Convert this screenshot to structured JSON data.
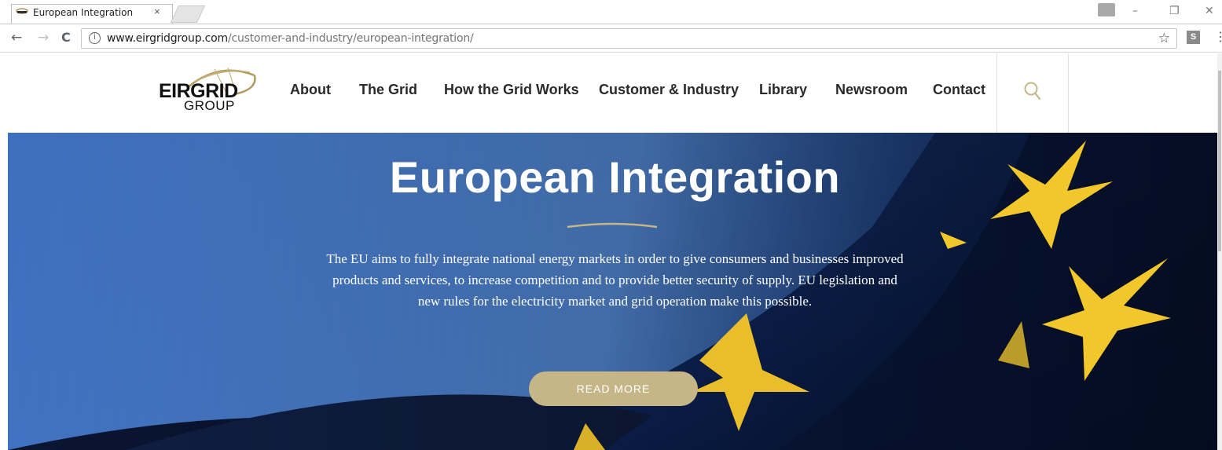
{
  "browser": {
    "tab_title": "European Integration",
    "tab_close": "×",
    "url_domain": "www.eirgridgroup.com",
    "url_path": "/customer-and-industry/european-integration/",
    "back": "←",
    "forward": "→",
    "reload": "C",
    "info": "i",
    "star": "☆",
    "ext": "S",
    "menu": "⋮",
    "minimize": "–",
    "restore": "❐",
    "close": "✕"
  },
  "site": {
    "logo_main": "EIRGRID",
    "logo_sub": "GROUP",
    "nav": [
      {
        "label": "About"
      },
      {
        "label": "The Grid"
      },
      {
        "label": "How the Grid Works"
      },
      {
        "label": "Customer & Industry"
      },
      {
        "label": "Library"
      },
      {
        "label": "Newsroom"
      },
      {
        "label": "Contact"
      }
    ]
  },
  "hero": {
    "title": "European Integration",
    "text": "The EU aims to fully integrate national energy markets in order to give consumers and businesses improved products and services, to increase competition and to provide better security of supply. EU legislation and new rules for the electricity market and grid operation make this possible.",
    "button": "READ MORE"
  },
  "colors": {
    "accent_gold": "#c6b586",
    "nav_text": "#2a2a2a"
  }
}
